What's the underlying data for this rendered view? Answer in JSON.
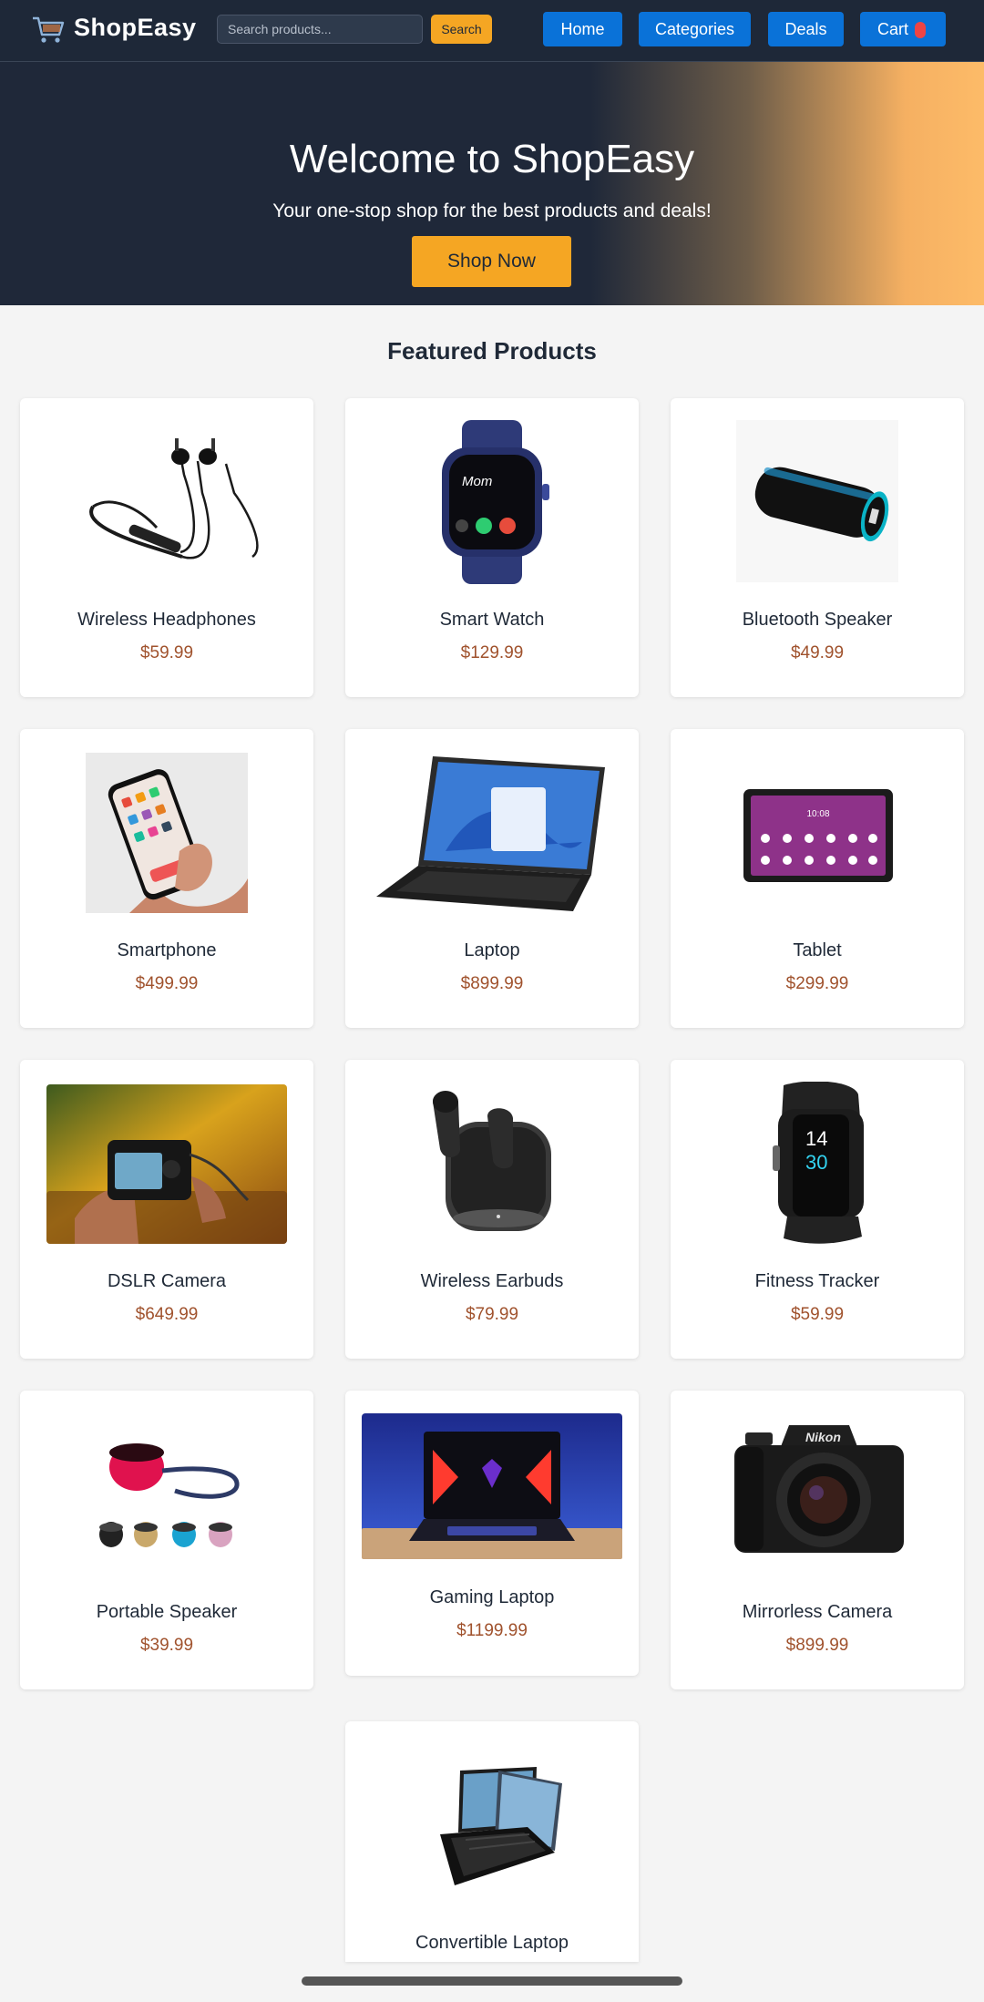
{
  "brand": {
    "name": "ShopEasy",
    "icon": "shopping-cart-icon"
  },
  "navbar": {
    "search_placeholder": "Search products...",
    "search_button": "Search",
    "links": {
      "home": "Home",
      "categories": "Categories",
      "deals": "Deals",
      "cart": "Cart"
    }
  },
  "hero": {
    "title": "Welcome to ShopEasy",
    "subtitle": "Your one-stop shop for the best products and deals!",
    "cta": "Shop Now"
  },
  "featured": {
    "title": "Featured Products",
    "products": [
      {
        "name": "Wireless Headphones",
        "price": "$59.99",
        "icon": "neckband-headphones-image"
      },
      {
        "name": "Smart Watch",
        "price": "$129.99",
        "icon": "smart-watch-image"
      },
      {
        "name": "Bluetooth Speaker",
        "price": "$49.99",
        "icon": "bluetooth-speaker-image"
      },
      {
        "name": "Smartphone",
        "price": "$499.99",
        "icon": "smartphone-image"
      },
      {
        "name": "Laptop",
        "price": "$899.99",
        "icon": "laptop-image"
      },
      {
        "name": "Tablet",
        "price": "$299.99",
        "icon": "tablet-image"
      },
      {
        "name": "DSLR Camera",
        "price": "$649.99",
        "icon": "dslr-camera-image"
      },
      {
        "name": "Wireless Earbuds",
        "price": "$79.99",
        "icon": "earbuds-image"
      },
      {
        "name": "Fitness Tracker",
        "price": "$59.99",
        "icon": "fitness-tracker-image"
      },
      {
        "name": "Portable Speaker",
        "price": "$39.99",
        "icon": "portable-speaker-image"
      },
      {
        "name": "Gaming Laptop",
        "price": "$1199.99",
        "icon": "gaming-laptop-image"
      },
      {
        "name": "Mirrorless Camera",
        "price": "$899.99",
        "icon": "mirrorless-camera-image"
      },
      {
        "name": "Convertible Laptop",
        "price": "",
        "icon": "convertible-laptop-image"
      }
    ]
  },
  "images_text": {
    "tracker_hour": "14",
    "tracker_min": "30",
    "tablet_clock": "10:08",
    "camera_brand": "Nikon",
    "watch_caller": "Mom"
  },
  "colors": {
    "navbar": "#1e2838",
    "accent": "#f5a623",
    "nav_button": "#0a72d8",
    "price": "#a0522d",
    "cart_badge": "#ef4444"
  }
}
